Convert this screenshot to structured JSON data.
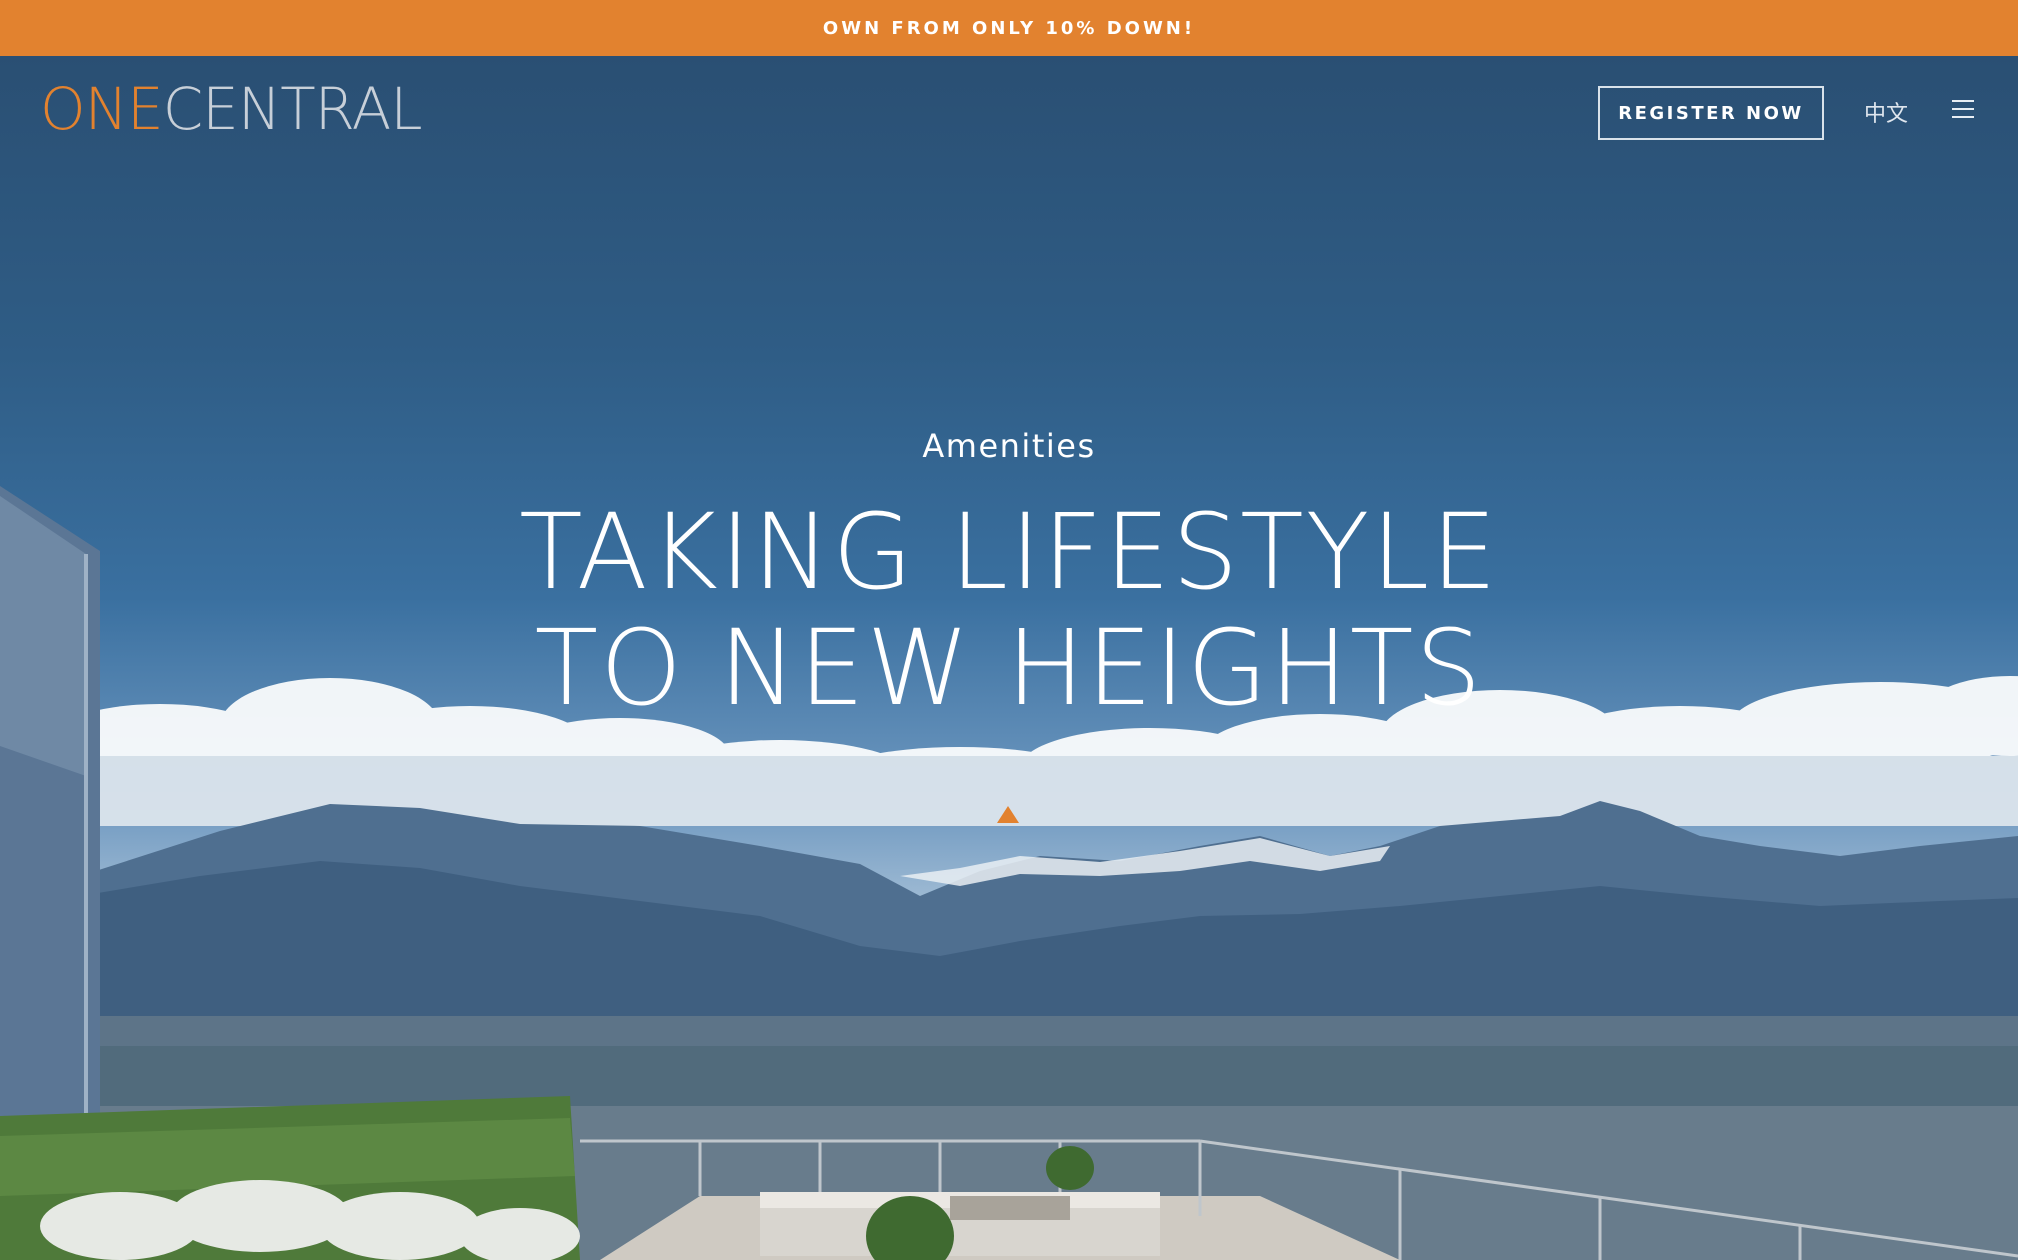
{
  "promo": {
    "text": "OWN FROM ONLY 10% DOWN!"
  },
  "header": {
    "logo_part1": "ONE",
    "logo_part2": "CENTRAL",
    "register_label": "REGISTER NOW",
    "language_label": "中文",
    "menu_icon": "hamburger-menu-icon"
  },
  "hero": {
    "eyebrow": "Amenities",
    "title": "TAKING LIFESTYLE TO NEW HEIGHTS",
    "scroll_icon": "triangle-up-icon"
  },
  "colors": {
    "accent": "#E2822F",
    "text": "#FFFFFF",
    "sky": "#2F5D86"
  }
}
